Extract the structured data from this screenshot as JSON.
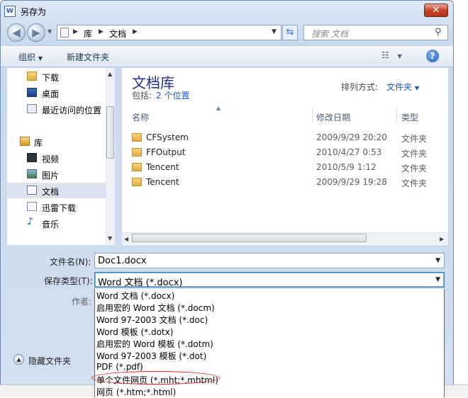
{
  "window": {
    "title": "另存为",
    "close_label": "✕"
  },
  "address": {
    "breadcrumb": [
      "库",
      "文档"
    ],
    "search_placeholder": "搜索 文档"
  },
  "toolbar": {
    "organize": "组织",
    "new_folder": "新建文件夹"
  },
  "nav": {
    "items": [
      {
        "label": "下载",
        "icon": "download-folder-icon"
      },
      {
        "label": "桌面",
        "icon": "desktop-icon"
      },
      {
        "label": "最近访问的位置",
        "icon": "recent-places-icon"
      },
      {
        "label": "库",
        "icon": "library-icon"
      },
      {
        "label": "视频",
        "icon": "video-icon"
      },
      {
        "label": "图片",
        "icon": "pictures-icon"
      },
      {
        "label": "文档",
        "icon": "documents-icon",
        "selected": true
      },
      {
        "label": "迅雷下载",
        "icon": "download-folder-icon"
      },
      {
        "label": "音乐",
        "icon": "music-icon"
      }
    ]
  },
  "library": {
    "title": "文档库",
    "includes_label": "包括:",
    "locations": "2 个位置",
    "arrange_label": "排列方式:",
    "arrange_value": "文件夹"
  },
  "columns": {
    "name": "名称",
    "modified": "修改日期",
    "type": "类型"
  },
  "files": [
    {
      "name": "CFSystem",
      "date": "2009/9/29 20:20",
      "type": "文件夹"
    },
    {
      "name": "FFOutput",
      "date": "2010/4/27 0:53",
      "type": "文件夹"
    },
    {
      "name": "Tencent",
      "date": "2010/5/9 1:12",
      "type": "文件夹"
    },
    {
      "name": "Tencent",
      "date": "2009/9/29 19:28",
      "type": "文件夹"
    }
  ],
  "form": {
    "filename_label": "文件名(N):",
    "filename_value": "Doc1.docx",
    "savetype_label": "保存类型(T):",
    "savetype_value": "Word 文档 (*.docx)",
    "author_label": "作者:"
  },
  "savetype_options": [
    "Word 文档 (*.docx)",
    "启用宏的 Word 文档 (*.docm)",
    "Word 97-2003 文档 (*.doc)",
    "Word 模板 (*.dotx)",
    "启用宏的 Word 模板 (*.dotm)",
    "Word 97-2003 模板 (*.dot)",
    "PDF (*.pdf)",
    "单个文件网页 (*.mht;*.mhtml)",
    "网页 (*.htm;*.html)"
  ],
  "highlighted_option": "单个文件网页 (*.mht;*.mhtml)",
  "highlight_color": "#e0221c",
  "hide_folders": "隐藏文件夹"
}
